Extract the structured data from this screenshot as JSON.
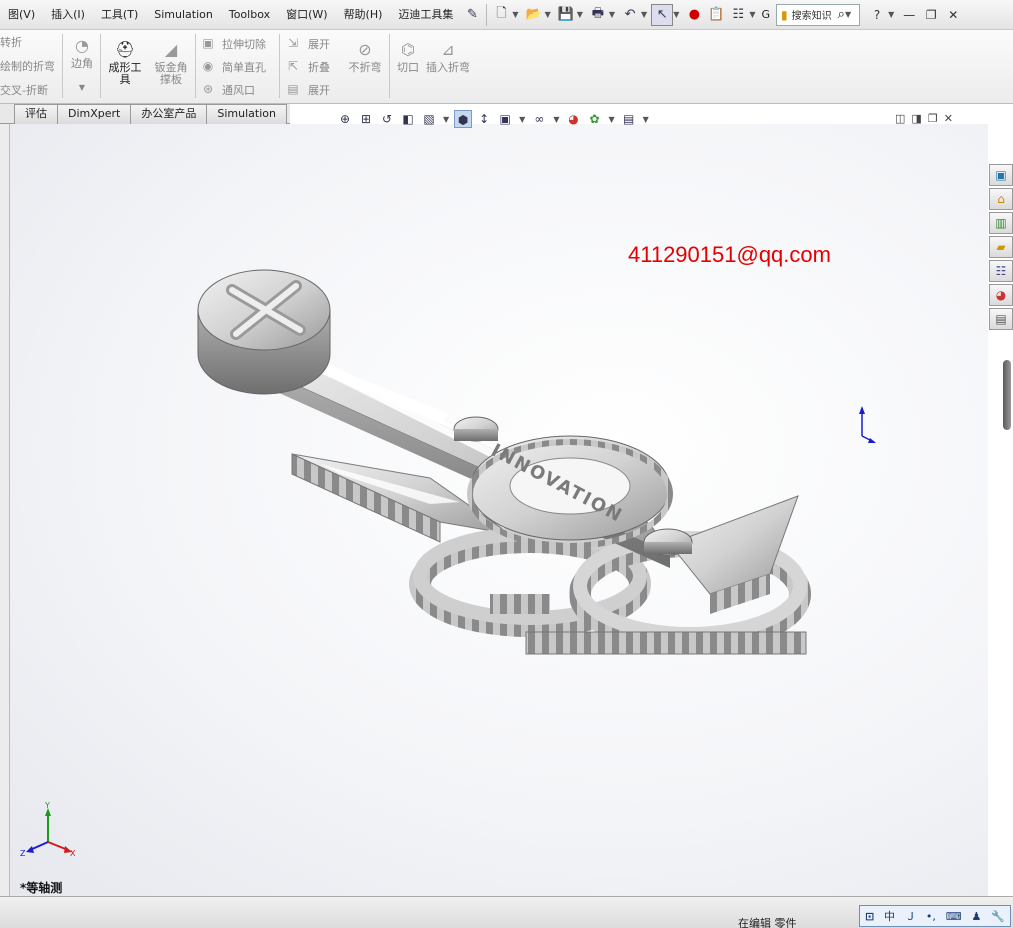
{
  "menubar": {
    "items": [
      "图(V)",
      "插入(I)",
      "工具(T)",
      "Simulation",
      "Toolbox",
      "窗口(W)",
      "帮助(H)",
      "迈迪工具集"
    ],
    "search_label": "搜索知识",
    "g_label": "G",
    "help_glyph": "?"
  },
  "ribbon": {
    "left_items": [
      "转折",
      "绘制的折弯",
      "交叉-折断"
    ],
    "edge_flange": "边角",
    "forming_tool": "成形工具",
    "gusset": "钣金角撑板",
    "extrude_cut": "拉伸切除",
    "simple_hole": "简单直孔",
    "vent": "通风口",
    "unfold": "展开",
    "fold": "折叠",
    "flatten": "展开",
    "no_bends": "不折弯",
    "rip": "切口",
    "insert_bends": "插入折弯"
  },
  "tabs": [
    "评估",
    "DimXpert",
    "办公室产品",
    "Simulation"
  ],
  "viewport": {
    "watermark": "411290151@qq.com",
    "view_name": "*等轴测",
    "model_text": "INNOVATION",
    "triad": {
      "y": "Y",
      "x": "X",
      "z": "Z"
    }
  },
  "statusbar": {
    "editing_label": "在编辑 零件",
    "ime": [
      "中",
      "Ｊ",
      "•,",
      "⌨",
      "♟",
      "🔧"
    ]
  },
  "colors": {
    "watermark": "#e40000",
    "model_fill": "#cfcfcf",
    "model_dark": "#8e8e8e"
  }
}
